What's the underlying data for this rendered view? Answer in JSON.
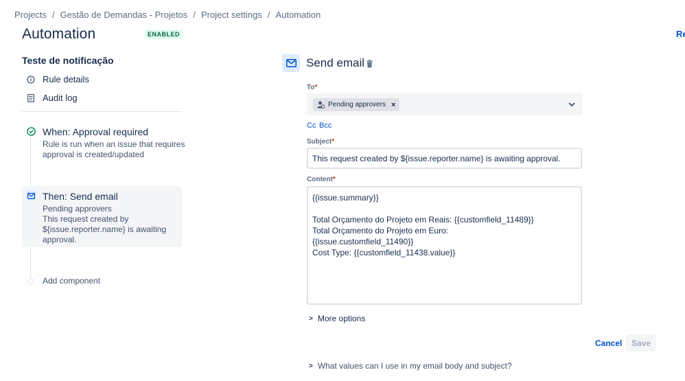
{
  "breadcrumb": {
    "items": [
      "Projects",
      "Gestão de Demandas - Projetos",
      "Project settings",
      "Automation"
    ]
  },
  "header": {
    "title": "Automation",
    "status_badge": "ENABLED",
    "right_link_partial": "Re"
  },
  "sidebar": {
    "rule_name": "Teste de notificação",
    "links": [
      {
        "label": "Rule details",
        "icon": "info-icon"
      },
      {
        "label": "Audit log",
        "icon": "document-icon"
      }
    ],
    "trigger": {
      "title": "When: Approval required",
      "description_lines": [
        "Rule is run when an issue that requires",
        "approval is created/updated"
      ],
      "icon": "check-circle-icon"
    },
    "action": {
      "title": "Then: Send email",
      "description_lines": [
        "Pending approvers",
        "This request created by",
        "${issue.reporter.name} is awaiting",
        "approval."
      ],
      "icon": "mail-icon"
    },
    "add_component": "Add component"
  },
  "editor": {
    "title": "Send email",
    "to": {
      "label": "To",
      "chip": "Pending approvers"
    },
    "cc_label": "Cc",
    "bcc_label": "Bcc",
    "subject": {
      "label": "Subject",
      "value": "This request created by ${issue.reporter.name} is awaiting approval."
    },
    "content": {
      "label": "Content",
      "lines": [
        "{{issue.summary}}",
        "",
        "Total Orçamento do Projeto em Reais: {{customfield_11489}}",
        "Total Orçamento do Projeto em Euro:",
        "{{issue.customfield_11490}}",
        "Cost Type: {{customfield_11438.value}}"
      ]
    },
    "more_options": "More options",
    "cancel": "Cancel",
    "save": "Save",
    "help": "What values can I use in my email body and subject?"
  },
  "colors": {
    "link": "#0052cc",
    "text": "#172b4d",
    "badge_bg": "#e3fcef",
    "badge_text": "#006644",
    "required": "#de350b"
  }
}
